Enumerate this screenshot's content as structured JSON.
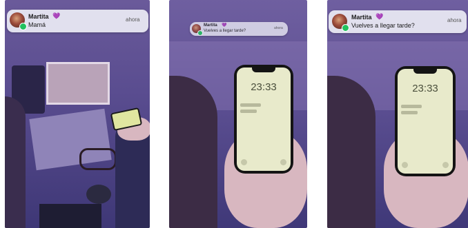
{
  "notifications": [
    {
      "sender": "Martita",
      "heart": "💜",
      "message": "Mamá",
      "time": "ahora"
    },
    {
      "sender": "Martita",
      "heart": "💜",
      "message": "Vuelves a llegar tarde?",
      "time": "ahora"
    },
    {
      "sender": "Martita",
      "heart": "💜",
      "message": "Vuelves a llegar tarde?",
      "time": "ahora"
    }
  ],
  "phones": [
    {
      "clock": "23:33"
    },
    {
      "clock": "23:33"
    }
  ],
  "icons": {
    "app": "whatsapp-icon",
    "avatar": "profile-photo"
  },
  "colors": {
    "overlay": "#5a4d90",
    "accent_heart": "#8a4fd6",
    "whatsapp": "#22c15e",
    "screen": "#e8eacb"
  }
}
